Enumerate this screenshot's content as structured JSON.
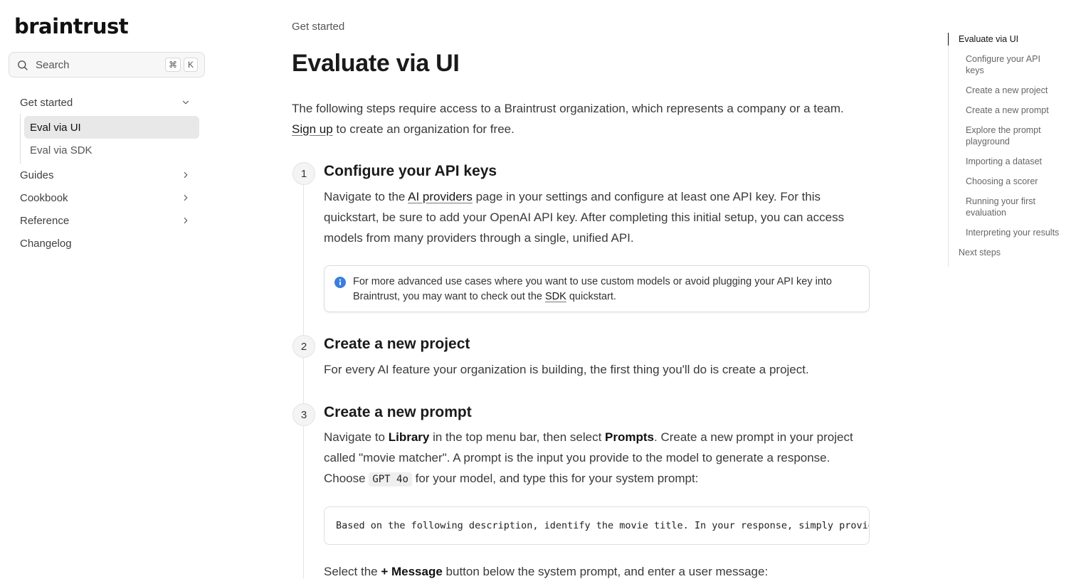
{
  "brand": {
    "logo_text": "braintrust"
  },
  "search": {
    "placeholder": "Search",
    "shortcut_mod": "⌘",
    "shortcut_key": "K"
  },
  "sidebar": {
    "sections": [
      {
        "label": "Get started",
        "expanded": true,
        "icon": "chevron-down-icon",
        "children": [
          {
            "label": "Eval via UI",
            "active": true
          },
          {
            "label": "Eval via SDK",
            "active": false
          }
        ]
      },
      {
        "label": "Guides",
        "icon": "chevron-right-icon"
      },
      {
        "label": "Cookbook",
        "icon": "chevron-right-icon"
      },
      {
        "label": "Reference",
        "icon": "chevron-right-icon"
      },
      {
        "label": "Changelog"
      }
    ]
  },
  "main": {
    "eyebrow": "Get started",
    "title": "Evaluate via UI",
    "intro_text": "The following steps require access to a Braintrust organization, which represents a company or a team.",
    "intro_link": "Sign up",
    "intro_after": " to create an organization for free.",
    "steps": [
      {
        "number": "1",
        "title": "Configure your API keys",
        "body_pre": "Navigate to the ",
        "body_link": "AI providers",
        "body_post": " page in your settings and configure at least one API key. For this quickstart, be sure to add your OpenAI API key. After completing this initial setup, you can access models from many providers through a single, unified API.",
        "callout_pre": "For more advanced use cases where you want to use custom models or avoid plugging your API key into Braintrust, you may want to check out the ",
        "callout_link": "SDK",
        "callout_post": " quickstart."
      },
      {
        "number": "2",
        "title": "Create a new project",
        "body": "For every AI feature your organization is building, the first thing you'll do is create a project."
      },
      {
        "number": "3",
        "title": "Create a new prompt",
        "body_a": "Navigate to ",
        "body_b1": "Library",
        "body_c": " in the top menu bar, then select ",
        "body_b2": "Prompts",
        "body_d": ". Create a new prompt in your project called \"movie matcher\". A prompt is the input you provide to the model to generate a response. Choose ",
        "body_code": "GPT 4o",
        "body_e": " for your model, and type this for your system prompt:",
        "code": "Based on the following description, identify the movie title. In your response, simply provide the name of the movie.",
        "after_pre": "Select the ",
        "after_bold": "+ Message",
        "after_post": " button below the system prompt, and enter a user message:"
      }
    ]
  },
  "toc": {
    "items": [
      {
        "label": "Evaluate via UI",
        "active": true,
        "level": 1
      },
      {
        "label": "Configure your API keys",
        "level": 2
      },
      {
        "label": "Create a new project",
        "level": 2
      },
      {
        "label": "Create a new prompt",
        "level": 2
      },
      {
        "label": "Explore the prompt playground",
        "level": 2
      },
      {
        "label": "Importing a dataset",
        "level": 2
      },
      {
        "label": "Choosing a scorer",
        "level": 2
      },
      {
        "label": "Running your first evaluation",
        "level": 2
      },
      {
        "label": "Interpreting your results",
        "level": 2
      },
      {
        "label": "Next steps",
        "level": 1
      }
    ]
  },
  "colors": {
    "info_icon": "#3b7ddd",
    "active_nav_bg": "#e8e8e8"
  }
}
